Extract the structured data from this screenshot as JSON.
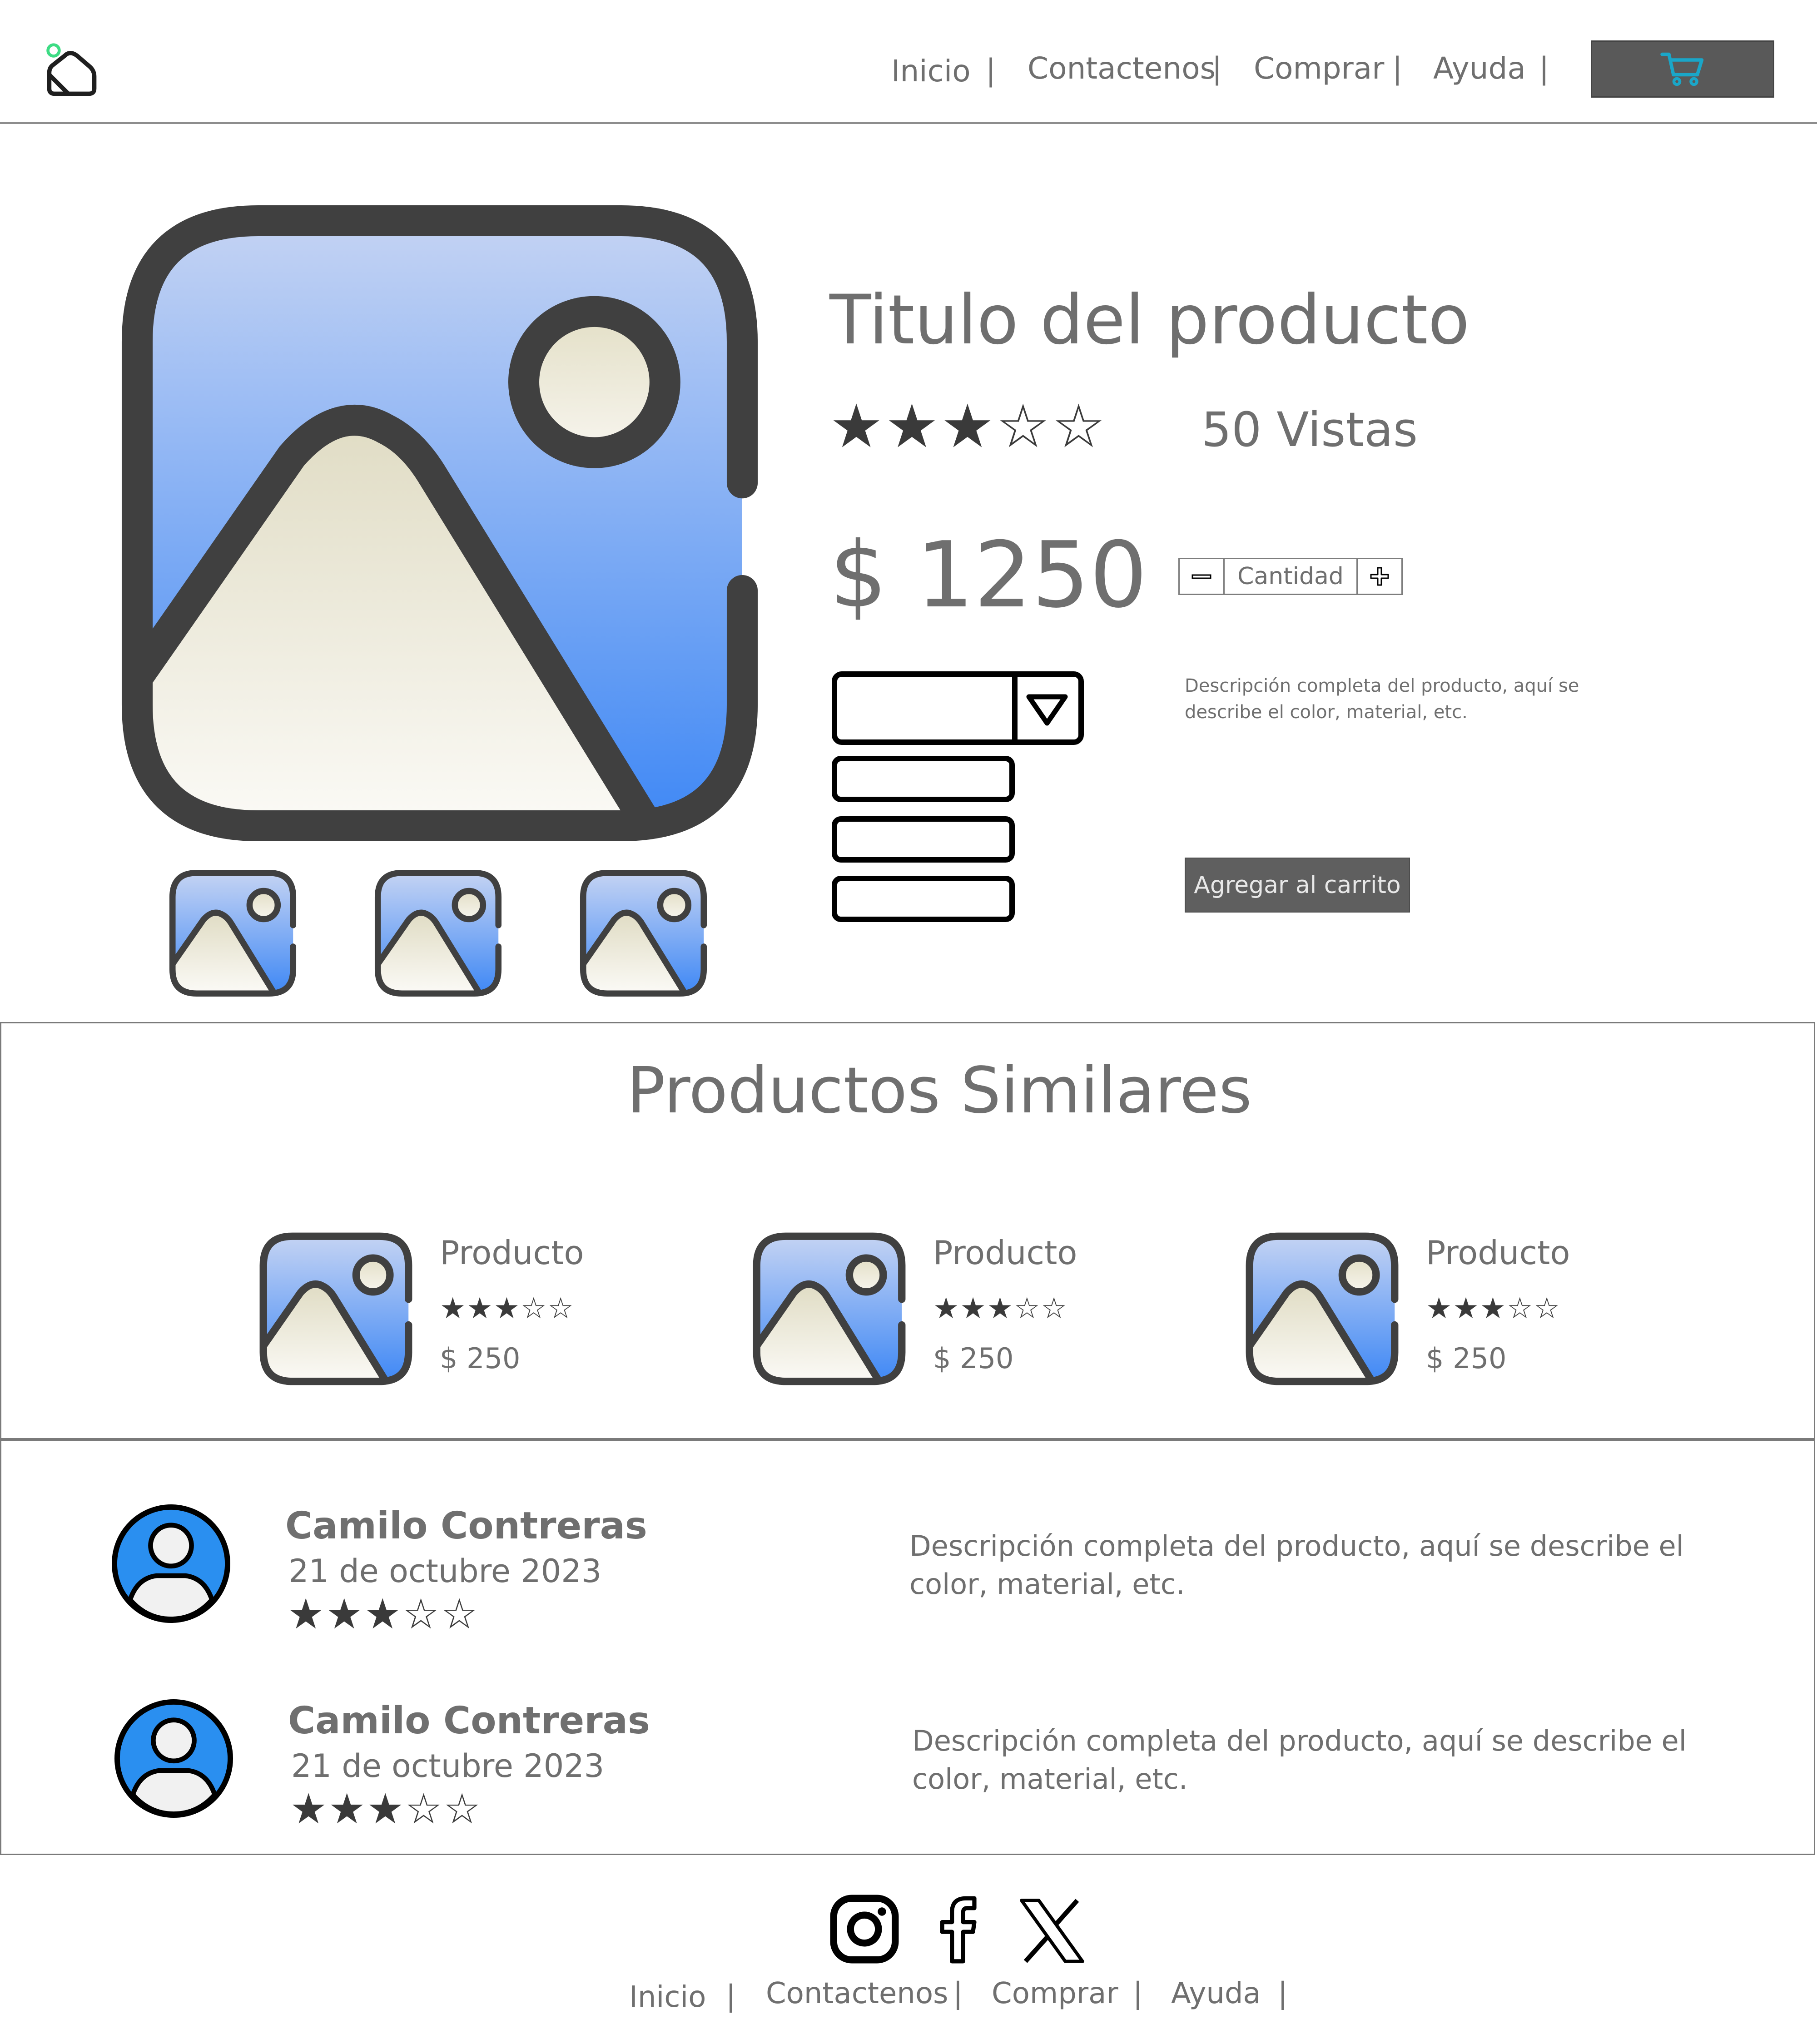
{
  "header": {
    "nav": [
      "Inicio",
      "Contactenos",
      "Comprar",
      "Ayuda"
    ],
    "separator": "|",
    "cart_icon": "cart-icon",
    "cart_icon_color": "#1aa6c8",
    "logo_accent": "#3ddc84"
  },
  "product": {
    "title": "Titulo del producto",
    "rating": 3,
    "rating_max": 5,
    "stars": "★★★☆☆",
    "views": "50 Vistas",
    "price": "$ 1250",
    "quantity_label": "Cantidad",
    "description": "Descripción completa del producto, aquí se describe el color, material, etc.",
    "add_to_cart": "Agregar al carrito",
    "thumbnail_count": 3
  },
  "similar": {
    "title": "Productos Similares",
    "items": [
      {
        "name": "Producto",
        "stars": "★★★☆☆",
        "price": "$ 250"
      },
      {
        "name": "Producto",
        "stars": "★★★☆☆",
        "price": "$ 250"
      },
      {
        "name": "Producto",
        "stars": "★★★☆☆",
        "price": "$ 250"
      }
    ]
  },
  "reviews": [
    {
      "name": "Camilo Contreras",
      "date": "21 de octubre 2023",
      "stars": "★★★☆☆",
      "text": "Descripción completa del producto, aquí se describe el color, material, etc."
    },
    {
      "name": "Camilo Contreras",
      "date": "21 de octubre 2023",
      "stars": "★★★☆☆",
      "text": "Descripción completa del producto, aquí se describe el color, material, etc."
    }
  ],
  "footer": {
    "social": [
      "instagram-icon",
      "facebook-icon",
      "x-icon"
    ],
    "nav": [
      "Inicio",
      "Contactenos",
      "Comprar",
      "Ayuda"
    ],
    "separator": "|"
  },
  "colors": {
    "image_gradient_top": "#c4d3f3",
    "image_gradient_bottom": "#3f88f5",
    "mountain": "#e5e1c9",
    "outline": "#404040",
    "avatar_blue": "#2a8ff0"
  }
}
